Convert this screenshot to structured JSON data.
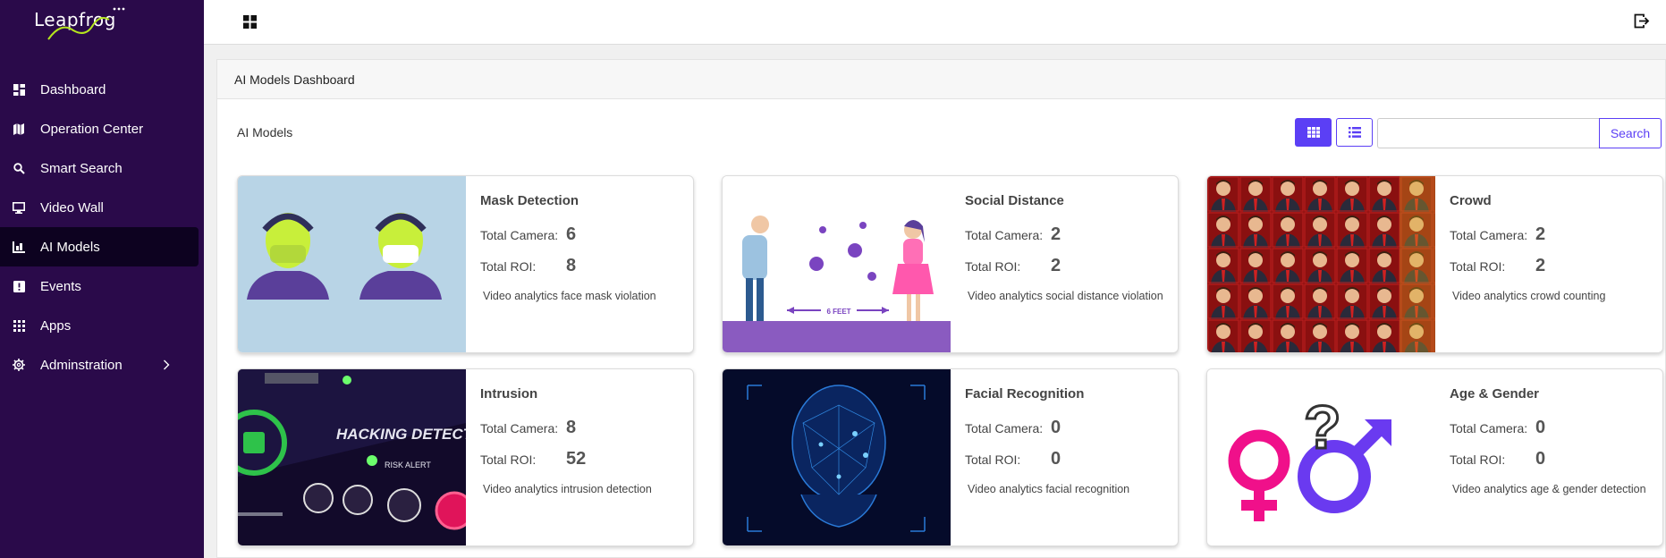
{
  "brand": {
    "name": "Leapfrog"
  },
  "sidebar": {
    "items": [
      {
        "label": "Dashboard",
        "icon": "dashboard-icon"
      },
      {
        "label": "Operation Center",
        "icon": "map-icon"
      },
      {
        "label": "Smart Search",
        "icon": "search-icon"
      },
      {
        "label": "Video Wall",
        "icon": "monitor-icon"
      },
      {
        "label": "AI Models",
        "icon": "chart-icon",
        "active": true
      },
      {
        "label": "Events",
        "icon": "alert-icon"
      },
      {
        "label": "Apps",
        "icon": "apps-icon"
      },
      {
        "label": "Adminstration",
        "icon": "gear-icon",
        "expandable": true
      }
    ]
  },
  "panel": {
    "header": "AI Models Dashboard",
    "section_title": "AI Models"
  },
  "search": {
    "placeholder": "",
    "value": "",
    "button": "Search"
  },
  "colors": {
    "sidebar_bg": "#2a0a4a",
    "accent": "#5b3ff5"
  },
  "cards": [
    {
      "title": "Mask Detection",
      "camera_label": "Total Camera:",
      "camera_value": "6",
      "roi_label": "Total ROI:",
      "roi_value": "8",
      "description": "Video analytics face mask violation"
    },
    {
      "title": "Social Distance",
      "camera_label": "Total Camera:",
      "camera_value": "2",
      "roi_label": "Total ROI:",
      "roi_value": "2",
      "description": "Video analytics social distance violation",
      "image_text": "6 FEET"
    },
    {
      "title": "Crowd",
      "camera_label": "Total Camera:",
      "camera_value": "2",
      "roi_label": "Total ROI:",
      "roi_value": "2",
      "description": "Video analytics crowd counting"
    },
    {
      "title": "Intrusion",
      "camera_label": "Total Camera:",
      "camera_value": "8",
      "roi_label": "Total ROI:",
      "roi_value": "52",
      "description": "Video analytics intrusion detection",
      "image_text": "HACKING DETECTE",
      "image_subtext": "RISK ALERT"
    },
    {
      "title": "Facial Recognition",
      "camera_label": "Total Camera:",
      "camera_value": "0",
      "roi_label": "Total ROI:",
      "roi_value": "0",
      "description": "Video analytics facial recognition"
    },
    {
      "title": "Age & Gender",
      "camera_label": "Total Camera:",
      "camera_value": "0",
      "roi_label": "Total ROI:",
      "roi_value": "0",
      "description": "Video analytics age & gender detection"
    }
  ]
}
